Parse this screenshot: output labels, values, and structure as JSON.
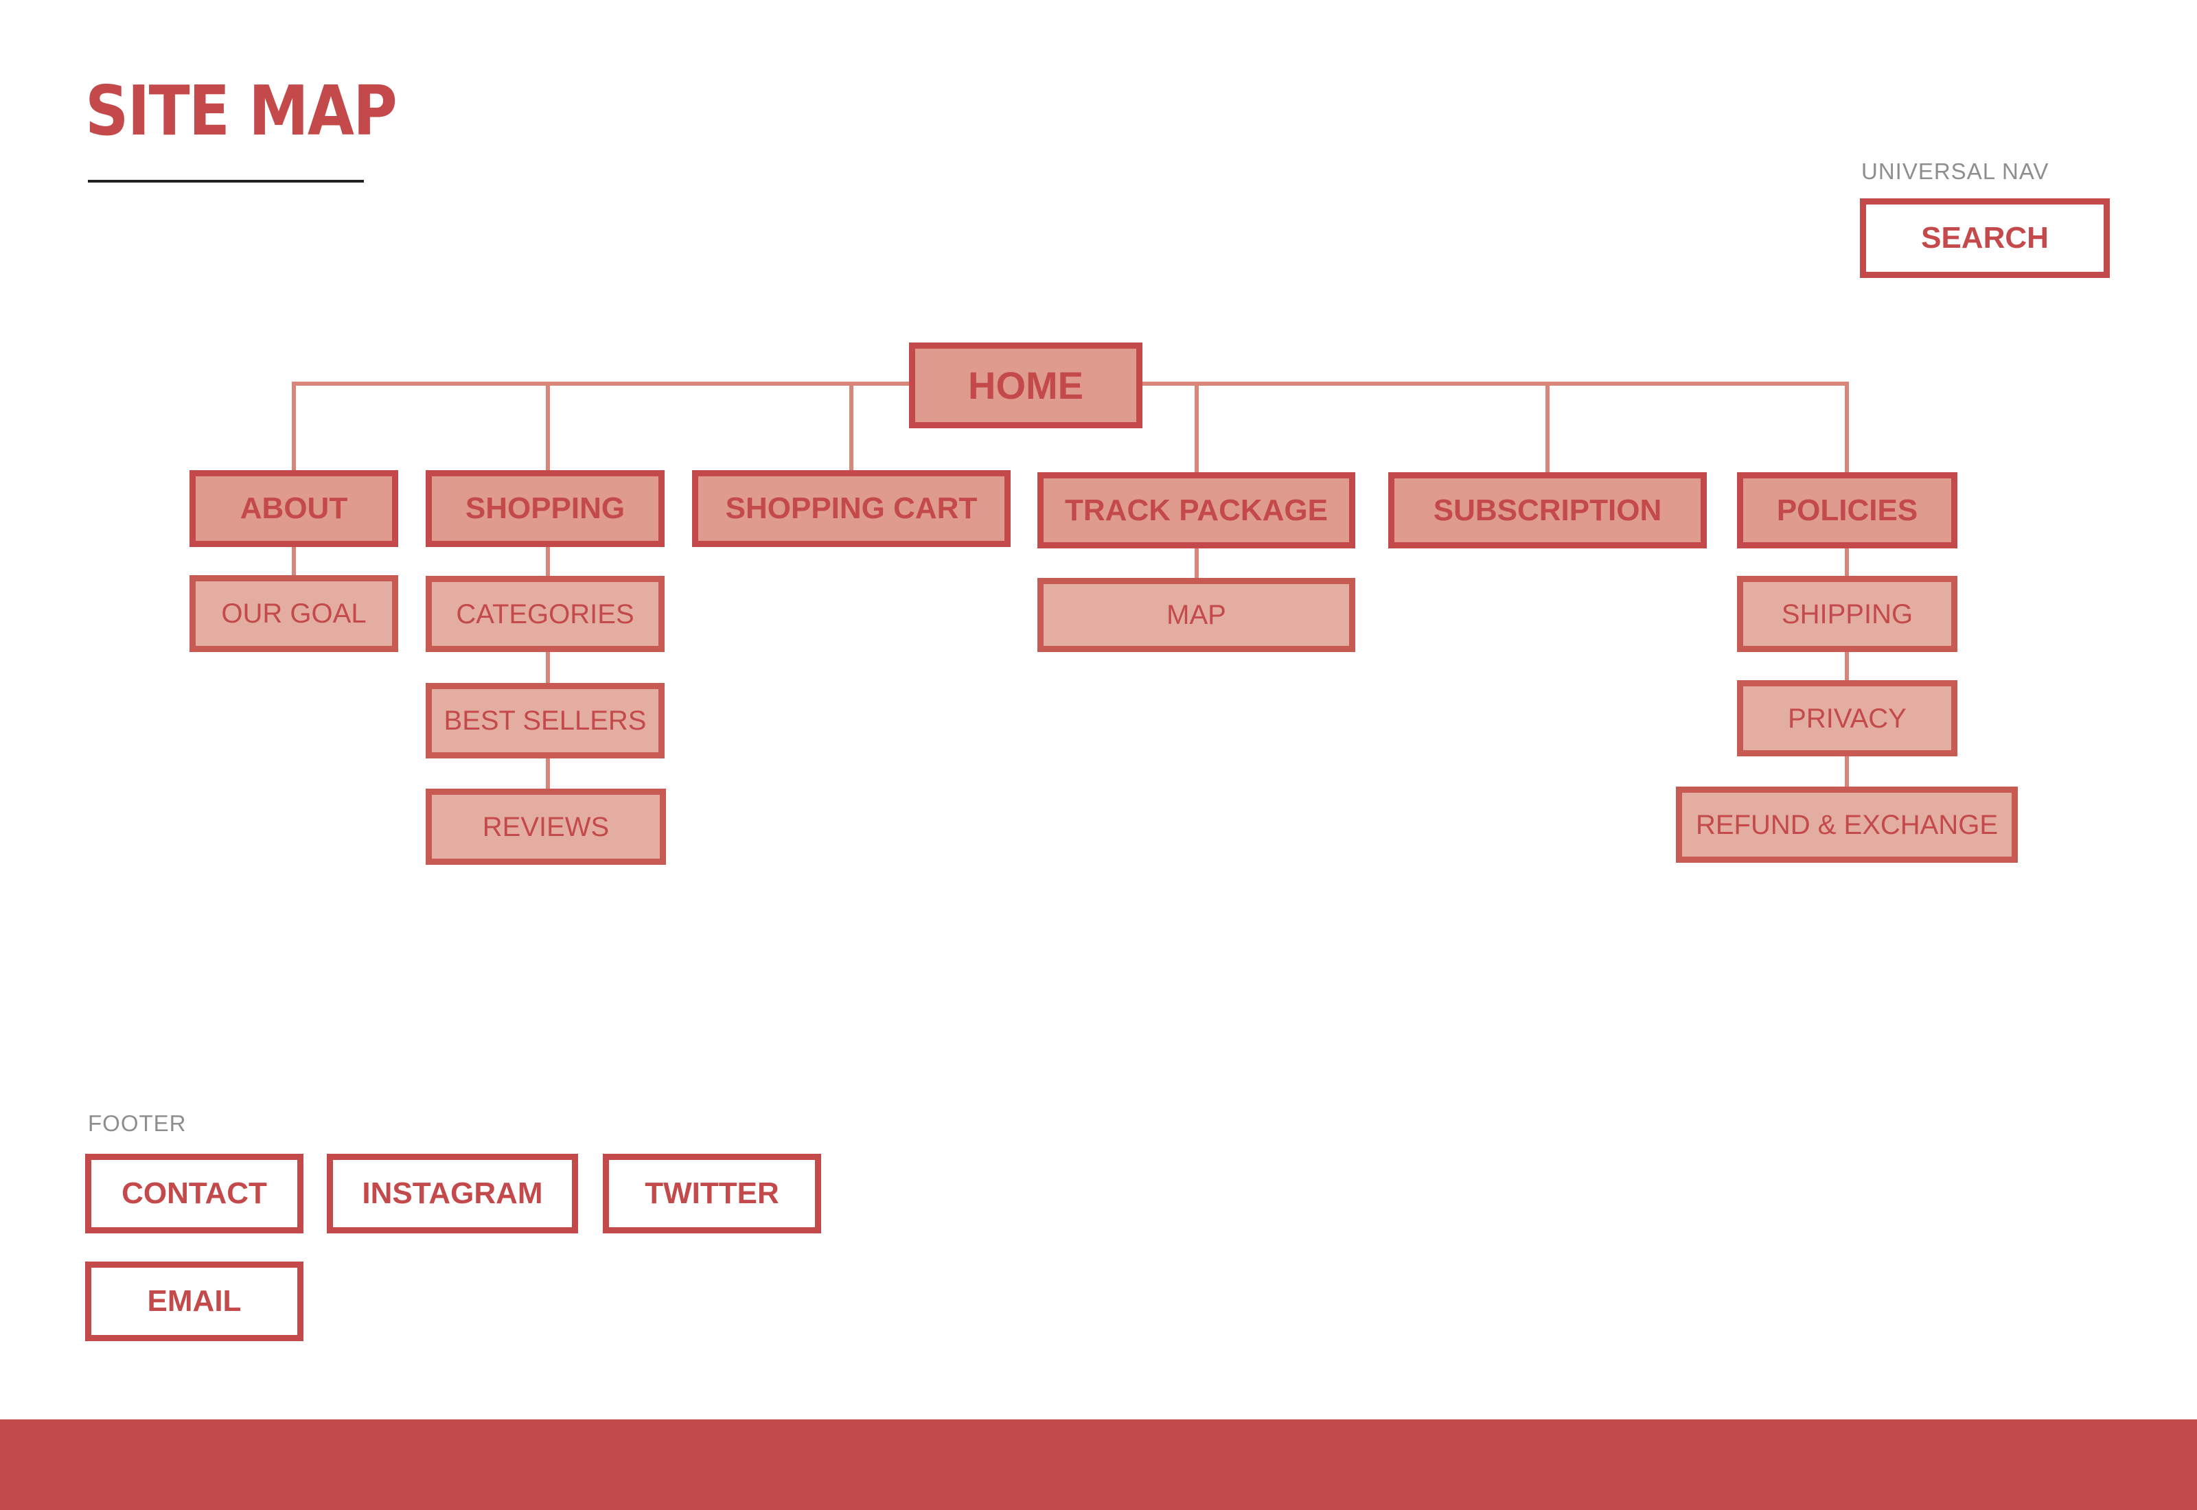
{
  "title": "SITE MAP",
  "universal_nav": {
    "label": "UNIVERSAL NAV",
    "items": [
      "SEARCH"
    ]
  },
  "tree": {
    "root": "HOME",
    "sections": [
      {
        "label": "ABOUT",
        "children": [
          "OUR GOAL"
        ]
      },
      {
        "label": "SHOPPING",
        "children": [
          "CATEGORIES",
          "BEST SELLERS",
          "REVIEWS"
        ]
      },
      {
        "label": "SHOPPING CART",
        "children": []
      },
      {
        "label": "TRACK PACKAGE",
        "children": [
          "MAP"
        ]
      },
      {
        "label": "SUBSCRIPTION",
        "children": []
      },
      {
        "label": "POLICIES",
        "children": [
          "SHIPPING",
          "PRIVACY",
          "REFUND & EXCHANGE"
        ]
      }
    ]
  },
  "footer": {
    "label": "FOOTER",
    "items": [
      "CONTACT",
      "INSTAGRAM",
      "TWITTER",
      "EMAIL"
    ]
  },
  "colors": {
    "accent": "#C4494A",
    "node_fill": "#DE9B8E",
    "child_fill": "#E3ADA2",
    "connector": "#D8857A",
    "band": "#C24A4A",
    "label_gray": "#8E8E8E"
  }
}
